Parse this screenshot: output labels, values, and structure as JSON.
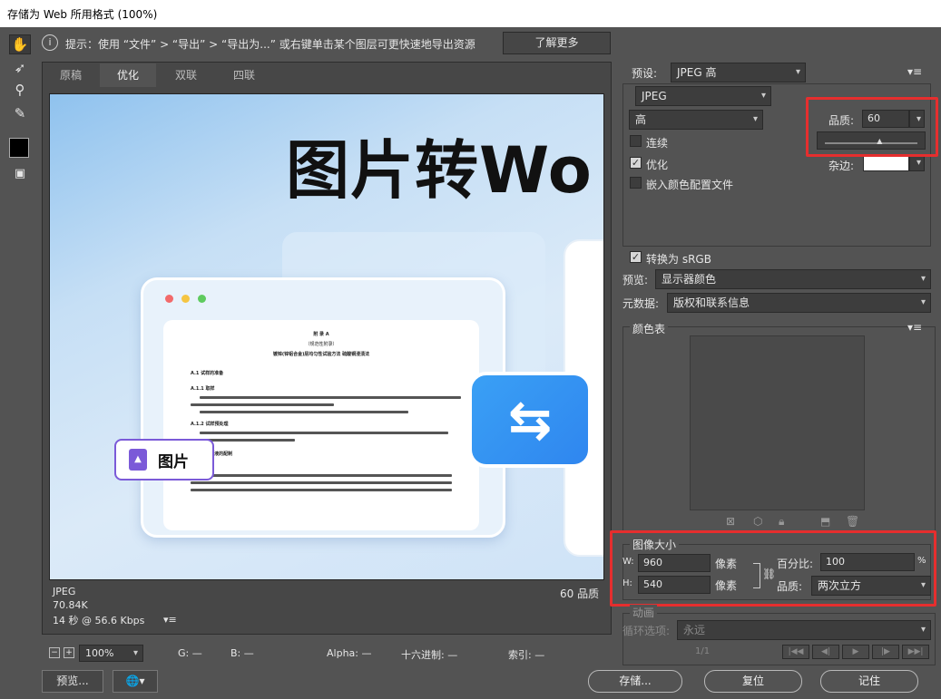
{
  "window": {
    "title": "存储为 Web 所用格式 (100%)"
  },
  "hint": {
    "text": "提示：使用 “文件” > “导出” > “导出为...” 或右键单击某个图层可更快速地导出资源",
    "learn_more": "了解更多"
  },
  "tabs": [
    "原稿",
    "优化",
    "双联",
    "四联"
  ],
  "active_tab": "优化",
  "preview_image": {
    "headline": "图片转Wo",
    "doc_title": "附 录 A",
    "doc_subtitle": "（规范性附录）",
    "doc_heading": "镀锌(锌铝合金)层均匀性试验方法 硫酸铜浸渍法",
    "doc_sections": [
      "A.1 试样的准备",
      "A.1.1 取样",
      "A.1.2 试样预处理",
      "A.2 试验溶液的配制",
      "A.2.1"
    ],
    "badge_label": "图片"
  },
  "image_info": {
    "format": "JPEG",
    "size": "70.84K",
    "speed": "14 秒 @ 56.6 Kbps",
    "quality_label": "60 品质"
  },
  "statusbar": {
    "zoom": "100%",
    "g": "G: —",
    "b": "B: —",
    "alpha": "Alpha: —",
    "hex": "十六进制: —",
    "index": "索引: —"
  },
  "settings": {
    "preset_label": "预设:",
    "preset_value": "JPEG 高",
    "format_value": "JPEG",
    "compression_value": "高",
    "quality_label": "品质:",
    "quality_value": "60",
    "quality_slider": 0.6,
    "progressive": "连续",
    "optimized": "优化",
    "embed_profile": "嵌入颜色配置文件",
    "matte_label": "杂边:",
    "convert_srgb": "转换为 sRGB",
    "preview_label": "预览:",
    "preview_value": "显示器颜色",
    "metadata_label": "元数据:",
    "metadata_value": "版权和联系信息"
  },
  "color_table": {
    "title": "颜色表"
  },
  "image_size": {
    "title": "图像大小",
    "w_label": "W:",
    "w_value": "960",
    "w_unit": "像素",
    "h_label": "H:",
    "h_value": "540",
    "h_unit": "像素",
    "percent_label": "百分比:",
    "percent_value": "100",
    "percent_unit": "%",
    "quality_label": "品质:",
    "quality_value": "两次立方"
  },
  "animation": {
    "title": "动画",
    "loop_label": "循环选项:",
    "loop_value": "永远",
    "frame": "1/1"
  },
  "buttons": {
    "preview": "预览...",
    "save": "存储...",
    "reset": "复位",
    "remember": "记住"
  }
}
